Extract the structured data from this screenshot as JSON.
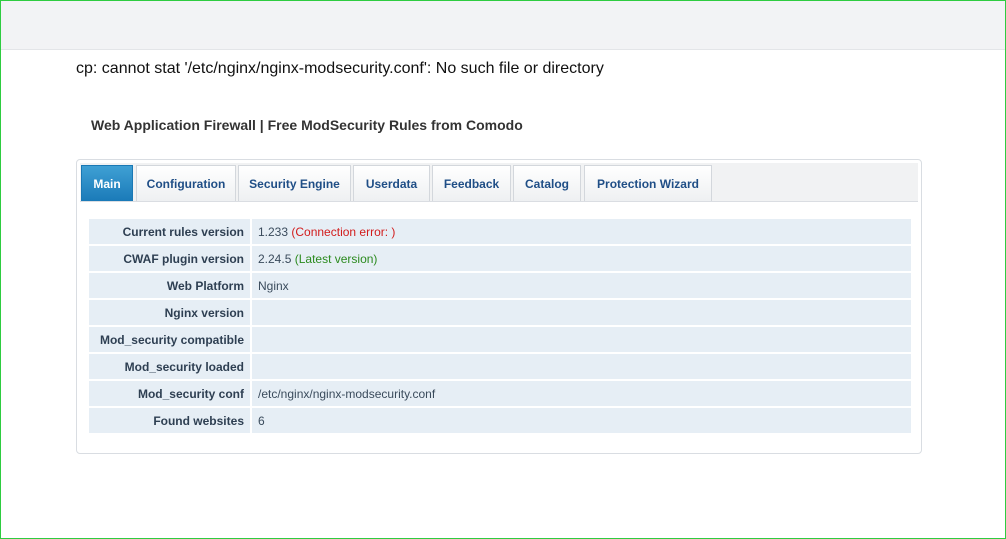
{
  "error_message": "cp: cannot stat '/etc/nginx/nginx-modsecurity.conf': No such file or directory",
  "page_title": "Web Application Firewall | Free ModSecurity Rules from Comodo",
  "tabs": [
    {
      "label": "Main",
      "active": true
    },
    {
      "label": "Configuration",
      "active": false
    },
    {
      "label": "Security Engine",
      "active": false
    },
    {
      "label": "Userdata",
      "active": false
    },
    {
      "label": "Feedback",
      "active": false
    },
    {
      "label": "Catalog",
      "active": false
    },
    {
      "label": "Protection Wizard",
      "active": false
    }
  ],
  "info_rows": [
    {
      "label": "Current rules version",
      "value": "1.233",
      "note": "(Connection error: )"
    },
    {
      "label": "CWAF plugin version",
      "value": "2.24.5",
      "note": "(Latest version)"
    },
    {
      "label": "Web Platform",
      "value": "Nginx",
      "note": ""
    },
    {
      "label": "Nginx version",
      "value": "",
      "note": ""
    },
    {
      "label": "Mod_security compatible",
      "value": "",
      "note": ""
    },
    {
      "label": "Mod_security loaded",
      "value": "",
      "note": ""
    },
    {
      "label": "Mod_security conf",
      "value": "/etc/nginx/nginx-modsecurity.conf",
      "note": ""
    },
    {
      "label": "Found websites",
      "value": "6",
      "note": ""
    }
  ],
  "colors": {
    "active_tab": "#1a7ab8",
    "error_text": "#d21c1c",
    "ok_text": "#2b8a1e",
    "row_background": "#e6eef5"
  }
}
